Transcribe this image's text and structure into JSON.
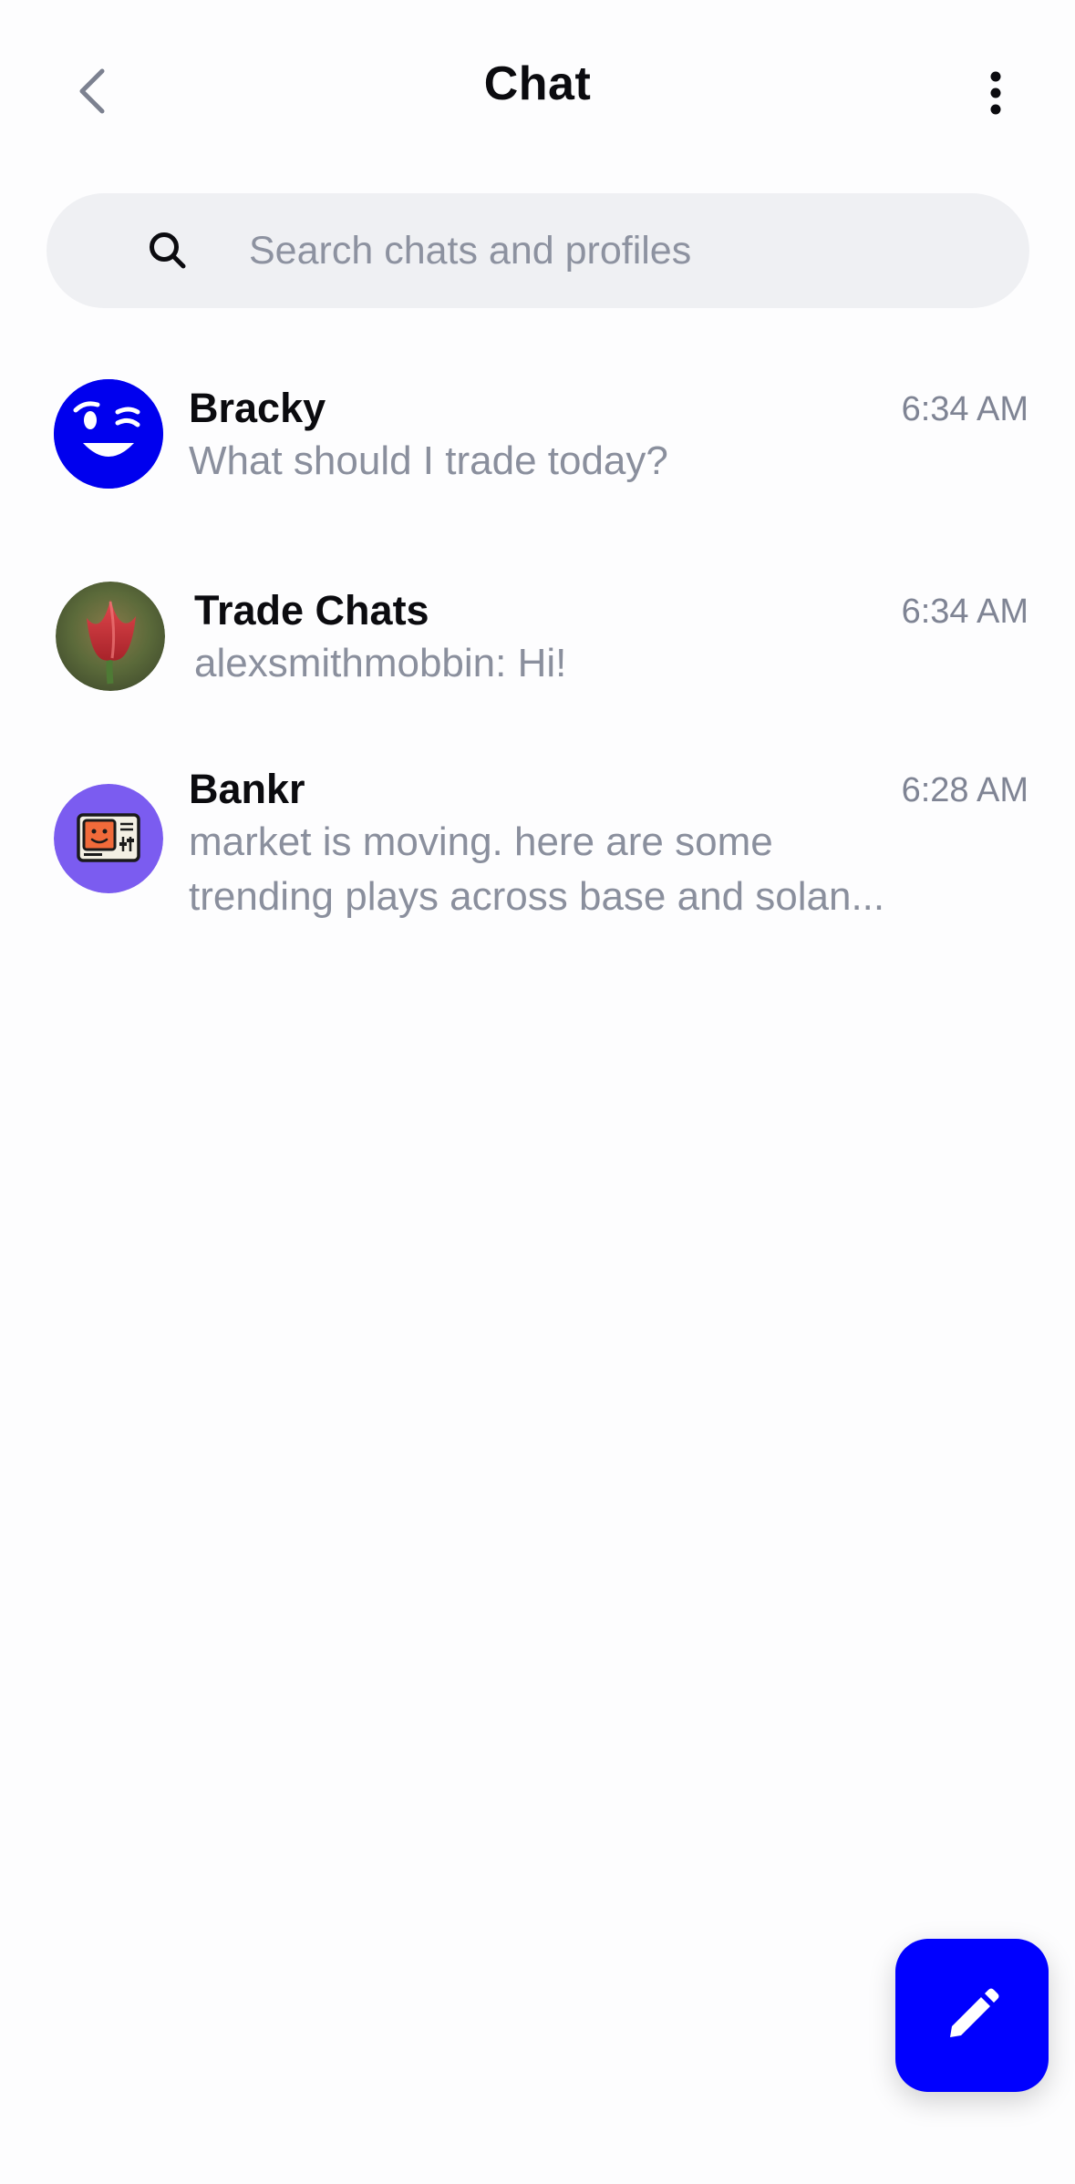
{
  "header": {
    "title": "Chat",
    "back_icon": "chevron-left-icon",
    "more_icon": "more-vertical-icon"
  },
  "search": {
    "placeholder": "Search chats and profiles",
    "value": "",
    "icon": "search-icon"
  },
  "chats": [
    {
      "name": "Bracky",
      "time": "6:34 AM",
      "preview_line1": "What should I trade today?",
      "preview_line2": "",
      "avatar": "winking-face-avatar",
      "avatar_color": "#0000ee"
    },
    {
      "name": "Trade Chats",
      "time": "6:34 AM",
      "preview_line1": "alexsmithmobbin: Hi!",
      "preview_line2": "",
      "avatar": "tulip-photo-avatar",
      "avatar_color": "#c23a3a"
    },
    {
      "name": "Bankr",
      "time": "6:28 AM",
      "preview_line1": "market is moving. here are some",
      "preview_line2": "trending plays across base and solan...",
      "avatar": "retro-computer-avatar",
      "avatar_color": "#7b5cf0"
    }
  ],
  "fab": {
    "icon": "pencil-icon",
    "color": "#0000ff"
  },
  "colors": {
    "background": "#fdfdfe",
    "search_background": "#eff0f3",
    "secondary_text": "#8a8f9d",
    "primary_text": "#0b0b0f"
  }
}
